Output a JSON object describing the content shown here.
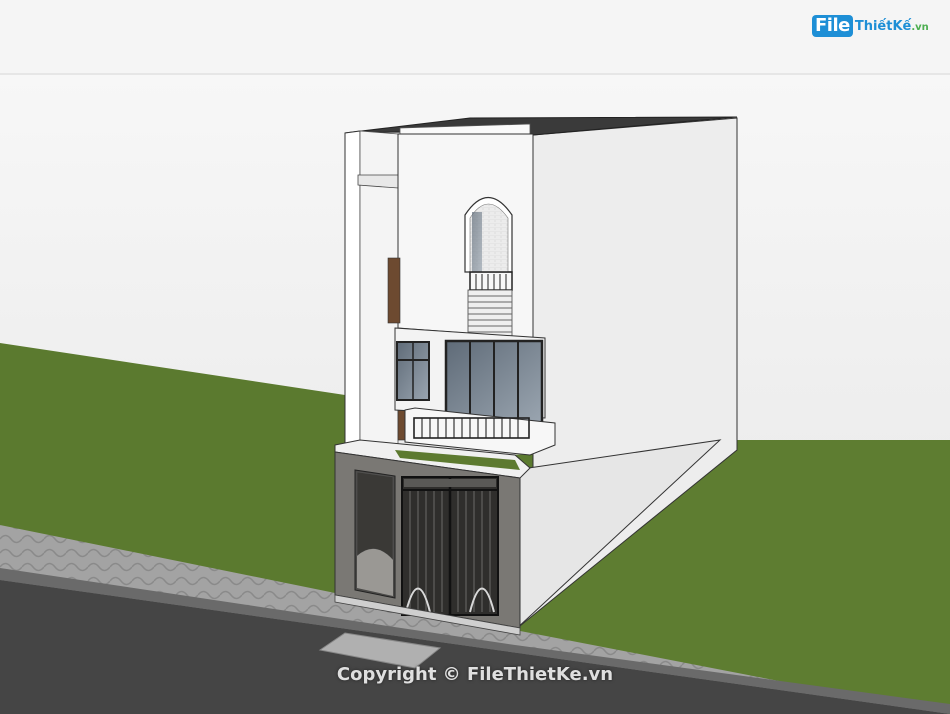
{
  "logo": {
    "badge": "File",
    "name": "ThiếtKế",
    "suffix": ".vn"
  },
  "watermark": {
    "text": "Copyright © FileThietKe.vn"
  },
  "colors": {
    "sky": "#e9e9e9",
    "sky_top": "#f7f7f7",
    "grass": "#5b7a2f",
    "sidewalk": "#9a9a9a",
    "road": "#4a4a4a",
    "wall": "#f2f2f2",
    "wall_shade": "#d9d9d9",
    "gray_facade": "#7a7874",
    "glass": "#7f8a96",
    "brand": "#1e8fd6"
  }
}
